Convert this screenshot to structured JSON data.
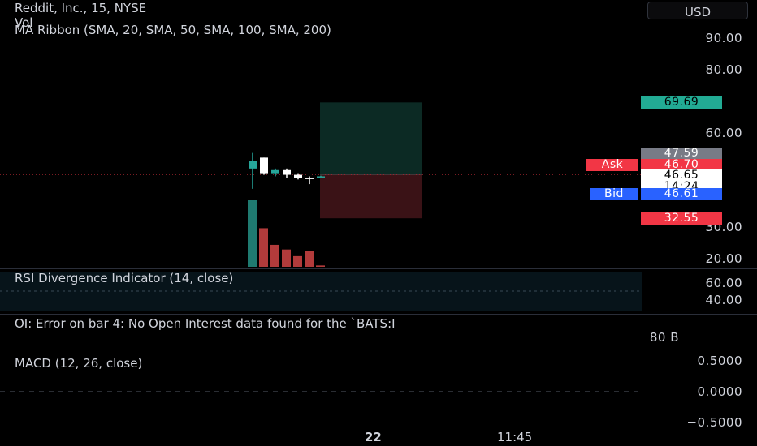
{
  "header": {
    "symbol_title": "Reddit, Inc., 15, NYSE",
    "vol_label": "Vol",
    "ma_ribbon_label": "MA Ribbon (SMA, 20, SMA, 50, SMA, 100, SMA, 200)",
    "currency": "USD"
  },
  "price_axis": {
    "ticks": [
      "90.00",
      "80.00",
      "60.00",
      "30.00",
      "20.00"
    ]
  },
  "tags": {
    "target": "69.69",
    "high": "47.59",
    "ask_label": "Ask",
    "ask_value": "46.70",
    "last": "46.65",
    "countdown": "14:24",
    "bid_label": "Bid",
    "bid_value": "46.61",
    "stop": "32.55"
  },
  "rsi": {
    "label": "RSI Divergence Indicator (14, close)",
    "ticks": [
      "60.00",
      "40.00"
    ]
  },
  "oi": {
    "label": "OI: Error on bar 4: No Open Interest data found for the `BATS:I",
    "tick": "80 B"
  },
  "macd": {
    "label": "MACD (12, 26, close)",
    "ticks": [
      "0.5000",
      "0.0000",
      "−0.5000"
    ]
  },
  "time_axis": {
    "ticks": [
      "22",
      "11:45"
    ]
  },
  "colors": {
    "up": "#26a69a",
    "down": "#ef5350",
    "target_zone": "#0c2a24",
    "stop_zone": "#3a1216",
    "ask": "#f23645",
    "bid": "#2962ff",
    "high": "#787b86"
  },
  "chart_data": {
    "type": "candlestick",
    "y_axis": {
      "range": [
        17,
        95
      ]
    },
    "candles": [
      {
        "open": 48.5,
        "high": 53.5,
        "low": 42.0,
        "close": 51.0
      },
      {
        "open": 52.0,
        "high": 52.0,
        "low": 46.5,
        "close": 47.0
      },
      {
        "open": 47.0,
        "high": 48.5,
        "low": 46.0,
        "close": 48.0
      },
      {
        "open": 48.0,
        "high": 48.5,
        "low": 45.5,
        "close": 46.5
      },
      {
        "open": 46.5,
        "high": 47.0,
        "low": 45.0,
        "close": 45.5
      },
      {
        "open": 45.5,
        "high": 46.0,
        "low": 43.5,
        "close": 45.3
      },
      {
        "open": 46.0,
        "high": 46.2,
        "low": 45.9,
        "close": 46.0
      }
    ],
    "volume": [
      {
        "value": 100,
        "direction": "up"
      },
      {
        "value": 58,
        "direction": "down"
      },
      {
        "value": 33,
        "direction": "down"
      },
      {
        "value": 26,
        "direction": "down"
      },
      {
        "value": 16,
        "direction": "down"
      },
      {
        "value": 24,
        "direction": "down"
      },
      {
        "value": 2,
        "direction": "down"
      }
    ],
    "position": {
      "entry": 46.65,
      "target": 69.69,
      "stop": 32.55
    },
    "current_price": 46.65
  }
}
